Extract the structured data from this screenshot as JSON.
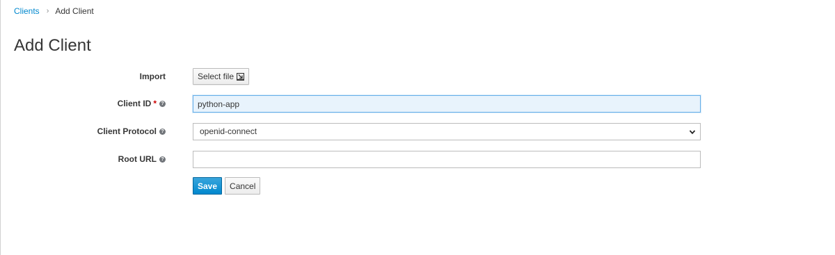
{
  "breadcrumb": {
    "parent": "Clients",
    "separator": "›",
    "current": "Add Client"
  },
  "page": {
    "title": "Add Client"
  },
  "form": {
    "import": {
      "label": "Import",
      "button_label": "Select file",
      "icon": "file-import-icon"
    },
    "client_id": {
      "label": "Client ID",
      "required_mark": "*",
      "value": "python-app",
      "help_icon": "question-circle-icon"
    },
    "client_protocol": {
      "label": "Client Protocol",
      "selected": "openid-connect",
      "help_icon": "question-circle-icon"
    },
    "root_url": {
      "label": "Root URL",
      "value": "",
      "help_icon": "question-circle-icon"
    },
    "actions": {
      "save_label": "Save",
      "cancel_label": "Cancel"
    }
  },
  "colors": {
    "link": "#0088ce",
    "primary": "#0088ce",
    "required": "#cc0000",
    "focus_border": "#66afe9"
  }
}
